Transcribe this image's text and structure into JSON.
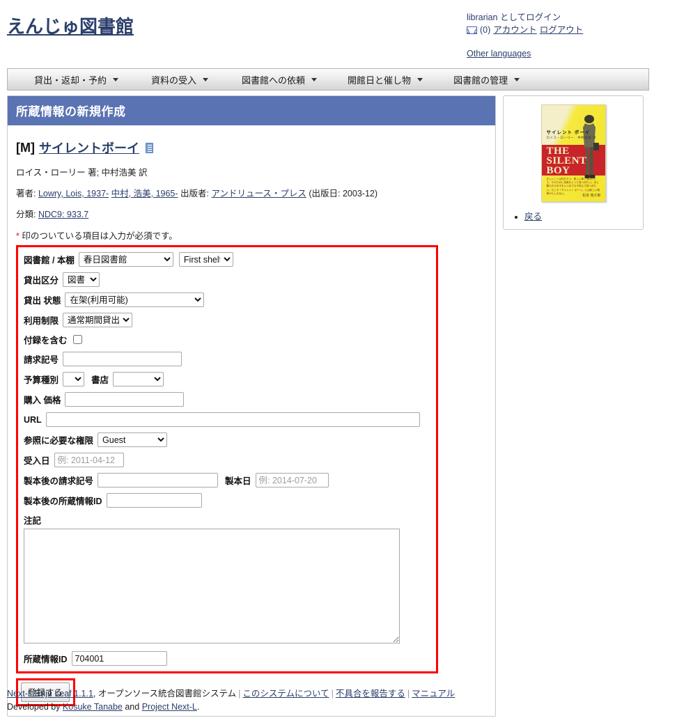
{
  "header": {
    "site_title": "えんじゅ図書館",
    "login_user": "librarian",
    "login_suffix": " としてログイン",
    "message_count": "(0)",
    "account_link": "アカウント",
    "logout_link": "ログアウト",
    "other_languages": "Other languages",
    "mail_icon": "mail-icon"
  },
  "menu": {
    "items": [
      {
        "label": "貸出・返却・予約"
      },
      {
        "label": "資料の受入"
      },
      {
        "label": "図書館への依頼"
      },
      {
        "label": "開館日と催し物"
      },
      {
        "label": "図書館の管理"
      }
    ]
  },
  "content": {
    "title": "所蔵情報の新規作成",
    "record": {
      "type_prefix": "[M]",
      "title": "サイレントボーイ",
      "statement": "ロイス・ローリー 著; 中村浩美 訳",
      "authors_label": "著者:",
      "author1": "Lowry, Lois, 1937-",
      "author2": "中村, 浩美, 1965-",
      "publisher_label": "出版者:",
      "publisher": "アンドリュース・プレス",
      "pubdate": "(出版日: 2003-12)",
      "classification_label": "分類:",
      "classification": "NDC9: 933.7"
    },
    "required_note_star": "*",
    "required_note": " 印のついている項目は入力が必須です。"
  },
  "form": {
    "library_shelf_label": "図書館 / 本棚",
    "library_value": "春日図書館",
    "library_options": [
      "春日図書館"
    ],
    "shelf_value": "First shelf",
    "shelf_options": [
      "First shelf"
    ],
    "circulation_label": "貸出区分",
    "circulation_value": "図書",
    "circulation_options": [
      "図書"
    ],
    "checkout_status_label": "貸出 状態",
    "checkout_status_value": "在架(利用可能)",
    "checkout_status_options": [
      "在架(利用可能)"
    ],
    "use_restriction_label": "利用制限",
    "use_restriction_value": "通常期間貸出",
    "use_restriction_options": [
      "通常期間貸出"
    ],
    "include_supplement_label": "付録を含む",
    "include_supplement_checked": false,
    "call_number_label": "請求記号",
    "call_number_value": "",
    "budget_type_label": "予算種別",
    "budget_type_value": "",
    "budget_type_options": [
      ""
    ],
    "bookstore_label": "書店",
    "bookstore_value": "",
    "bookstore_options": [
      ""
    ],
    "price_label": "購入 価格",
    "price_value": "",
    "url_label": "URL",
    "url_value": "",
    "required_role_label": "参照に必要な権限",
    "required_role_value": "Guest",
    "required_role_options": [
      "Guest"
    ],
    "acquired_at_label": "受入日",
    "acquired_at_value": "",
    "acquired_at_placeholder": "例: 2011-04-12",
    "binding_call_number_label": "製本後の請求記号",
    "binding_call_number_value": "",
    "binded_at_label": "製本日",
    "binded_at_value": "",
    "binded_at_placeholder": "例: 2014-07-20",
    "binding_item_id_label": "製本後の所蔵情報ID",
    "binding_item_id_value": "",
    "note_label": "注記",
    "note_value": "",
    "item_identifier_label": "所蔵情報ID",
    "item_identifier_value": "704001",
    "submit_label": "登録する"
  },
  "sidebar": {
    "cover": {
      "jp_title": "サイレント ボーイ",
      "jp_author": "ロイス・ローリー　中村浩美 訳",
      "en_line1": "THE",
      "en_line2": "SILENT",
      "en_line3": "BOY",
      "blurb": "正しいことは何だろう。美しい事とは何だろう。そのために真実をじっと見つめたい。光と闇のきらめきをいつまでも子供心で見つめたい。もしや「サイレント ボーイ」とは新しい精神かもしれない。",
      "signature": "松本 侑子郎"
    },
    "back_link": "戻る"
  },
  "footer": {
    "app_link": "Next-L Enju Leaf 1.1.1",
    "app_desc": ", オープンソース統合図書館システム",
    "about_link": "このシステムについて",
    "report_link": "不具合を報告する",
    "manual_link": "マニュアル",
    "developed_by": "Developed by ",
    "developer": "Kosuke Tanabe",
    "and_text": " and ",
    "project": "Project Next-L",
    "period": "."
  },
  "colors": {
    "title_bar": "#5a73b3",
    "link": "#2b3f6b",
    "highlight_border": "#fe0000"
  }
}
